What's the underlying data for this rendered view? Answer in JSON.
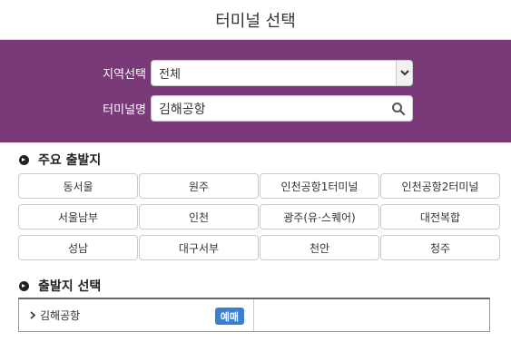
{
  "dialog": {
    "title": "터미널 선택"
  },
  "filters": {
    "region_label": "지역선택",
    "region_value": "전체",
    "terminal_label": "터미널명",
    "terminal_value": "김해공항"
  },
  "major_departures": {
    "heading": "주요 출발지",
    "terminals": [
      "동서울",
      "원주",
      "인천공항1터미널",
      "인천공항2터미널",
      "서울남부",
      "인천",
      "광주(유·스퀘어)",
      "대전복합",
      "성남",
      "대구서부",
      "천안",
      "청주"
    ]
  },
  "departure_select": {
    "heading": "출발지 선택",
    "selected_item": "김해공항",
    "badge": "예매"
  },
  "colors": {
    "filter_panel_bg": "#7a3a7a",
    "badge_bg": "#3a7fd0"
  }
}
